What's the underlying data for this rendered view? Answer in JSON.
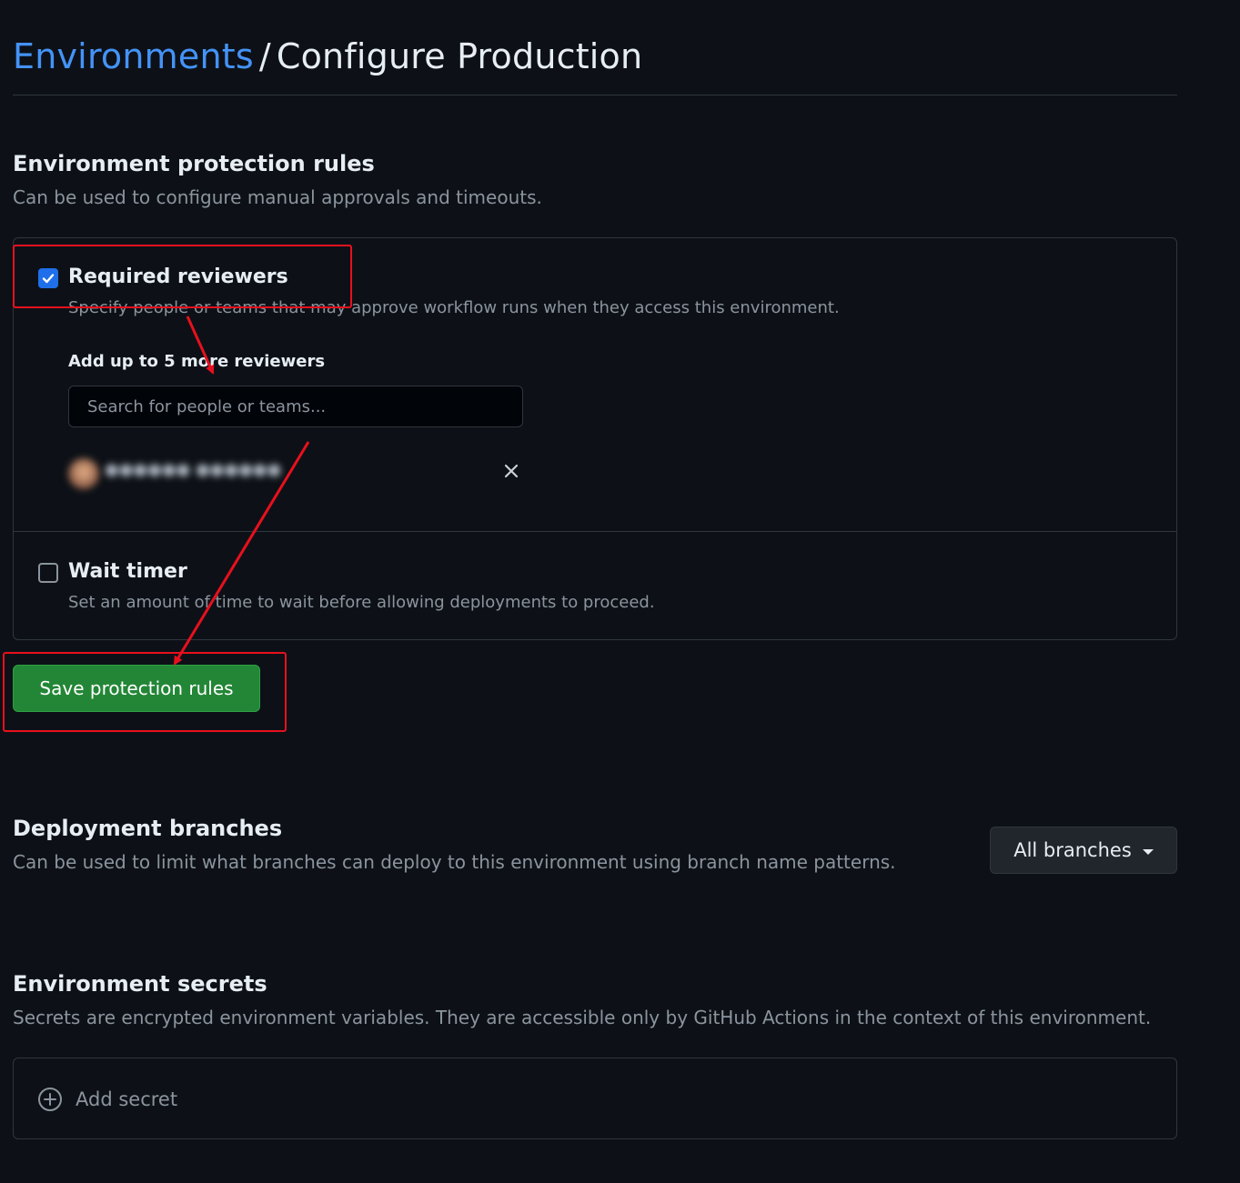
{
  "header": {
    "breadcrumb_link": "Environments",
    "separator": "/",
    "current": "Configure Production"
  },
  "protection_rules": {
    "heading": "Environment protection rules",
    "description": "Can be used to configure manual approvals and timeouts.",
    "required_reviewers": {
      "checked": true,
      "label": "Required reviewers",
      "description": "Specify people or teams that may approve workflow runs when they access this environment.",
      "add_label": "Add up to 5 more reviewers",
      "search_placeholder": "Search for people or teams..."
    },
    "wait_timer": {
      "checked": false,
      "label": "Wait timer",
      "description": "Set an amount of time to wait before allowing deployments to proceed."
    },
    "save_label": "Save protection rules"
  },
  "deployment_branches": {
    "heading": "Deployment branches",
    "description": "Can be used to limit what branches can deploy to this environment using branch name patterns.",
    "dropdown_value": "All branches"
  },
  "secrets": {
    "heading": "Environment secrets",
    "description": "Secrets are encrypted environment variables. They are accessible only by GitHub Actions in the context of this environment.",
    "add_label": "Add secret"
  },
  "icons": {
    "checkbox_check": "check-icon",
    "remove_reviewer": "x-icon",
    "dropdown": "caret-down-icon",
    "add_secret": "plus-circle-icon"
  },
  "colors": {
    "background": "#0d1117",
    "link": "#4493f8",
    "primary_button": "#238636",
    "checkbox_checked": "#1f6feb",
    "annotation": "#e8101d"
  }
}
